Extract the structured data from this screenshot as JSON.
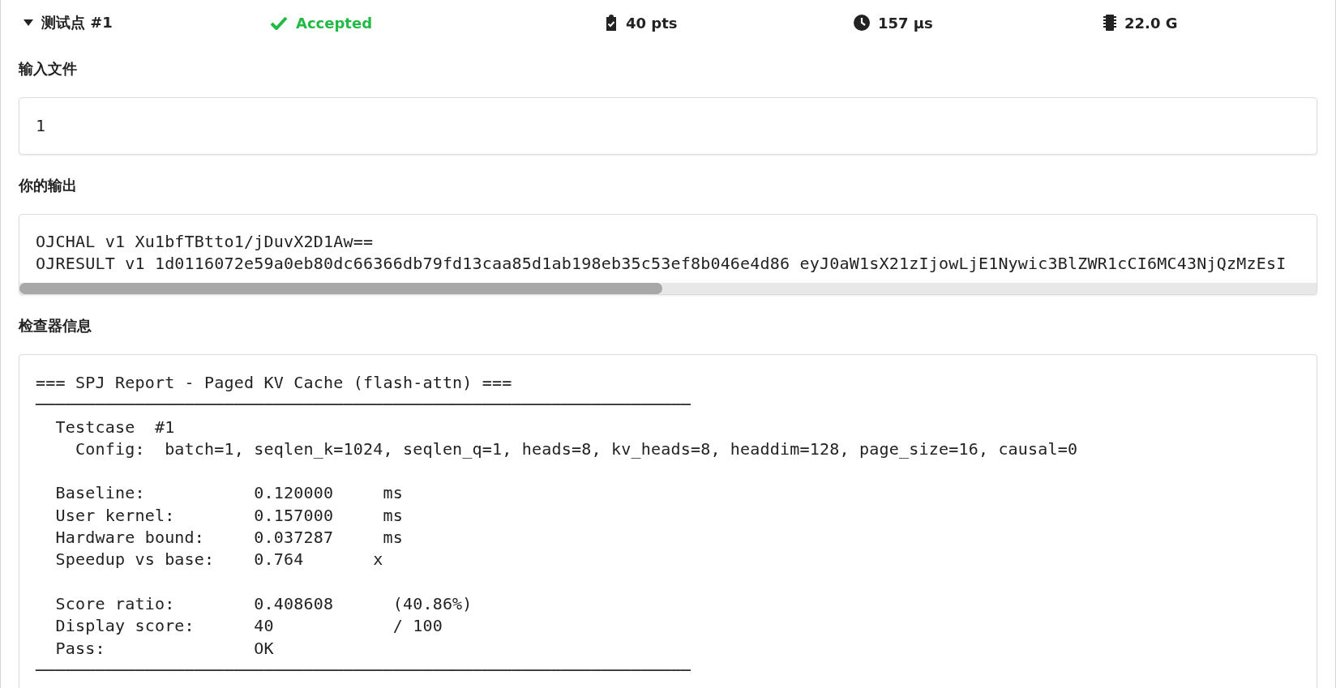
{
  "testcase": {
    "title": "测试点 #1",
    "expanded": true,
    "status": "Accepted",
    "accepted": true,
    "score": "40 pts",
    "time": "157 µs",
    "memory": "22.0 G"
  },
  "sections": [
    {
      "title": "输入文件",
      "kind": "plain",
      "lines": [
        "1"
      ]
    },
    {
      "title": "你的输出",
      "kind": "scroll",
      "lines": [
        "OJCHAL v1 Xu1bfTBtto1/jDuvX2D1Aw==",
        "OJRESULT v1 1d0116072e59a0eb80dc66366db79fd13caa85d1ab198eb35c53ef8b046e4d86 eyJ0aW1sX21zIjowLjE1Nywic3BlZWR1cCI6MC43NjQzMzEsI"
      ]
    },
    {
      "title": "检查器信息",
      "kind": "report",
      "lines": [
        {
          "kind": "text",
          "text": "=== SPJ Report - Paged KV Cache (flash-attn) ==="
        },
        {
          "kind": "text",
          "text": "──────────────────────────────────────────────────────────────────"
        },
        {
          "kind": "text",
          "text": "  Testcase  #1"
        },
        {
          "kind": "text",
          "text": "    Config:  batch=1, seqlen_k=1024, seqlen_q=1, heads=8, kv_heads=8, headdim=128, page_size=16, causal=0"
        },
        {
          "kind": "gap"
        },
        {
          "kind": "text",
          "text": "  Baseline:           0.120000     ms"
        },
        {
          "kind": "text",
          "text": "  User kernel:        0.157000     ms"
        },
        {
          "kind": "text",
          "text": "  Hardware bound:     0.037287     ms"
        },
        {
          "kind": "text",
          "text": "  Speedup vs base:    0.764       x"
        },
        {
          "kind": "gap"
        },
        {
          "kind": "text",
          "text": "  Score ratio:        0.408608      (40.86%)"
        },
        {
          "kind": "text",
          "text": "  Display score:      40            / 100"
        },
        {
          "kind": "text",
          "text": "  Pass:               OK"
        },
        {
          "kind": "text",
          "text": "──────────────────────────────────────────────────────────────────"
        }
      ]
    }
  ]
}
